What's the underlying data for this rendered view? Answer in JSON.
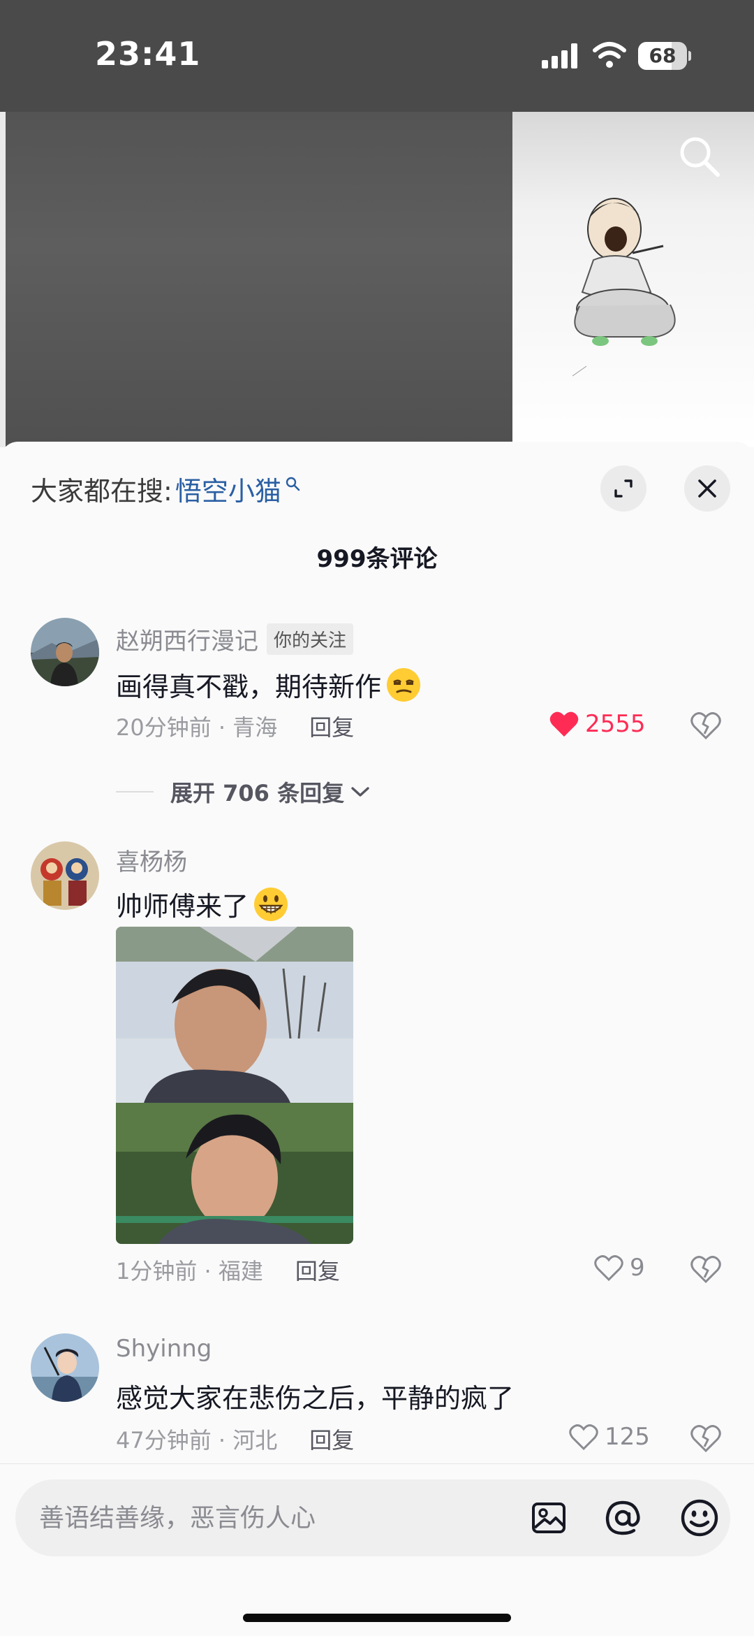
{
  "status_bar": {
    "time": "23:41",
    "battery": "68",
    "battery_level": 0.68
  },
  "video": {
    "search_icon": "search-icon"
  },
  "sheet": {
    "search_hint_label": "大家都在搜:",
    "search_hint_term": "悟空小猫",
    "comment_count": "999条评论"
  },
  "comments": [
    {
      "username": "赵朔西行漫记",
      "tag": "你的关注",
      "text": "画得真不戳，期待新作",
      "time": "20分钟前 · 青海",
      "reply": "回复",
      "likes": "2555",
      "liked": true,
      "expand_replies": "展开 706 条回复"
    },
    {
      "username": "喜杨杨",
      "text": "帅师傅来了",
      "time": "1分钟前 · 福建",
      "reply": "回复",
      "likes": "9",
      "liked": false
    },
    {
      "username": "Shyinng",
      "text": "感觉大家在悲伤之后，平静的疯了",
      "time": "47分钟前 · 河北",
      "reply": "回复",
      "likes": "125",
      "liked": false
    }
  ],
  "input": {
    "placeholder": "善语结善缘，恶言伤人心"
  },
  "colors": {
    "accent_like": "#fe2c55",
    "link": "#2a5fa3",
    "muted_text": "#8a8b91"
  }
}
